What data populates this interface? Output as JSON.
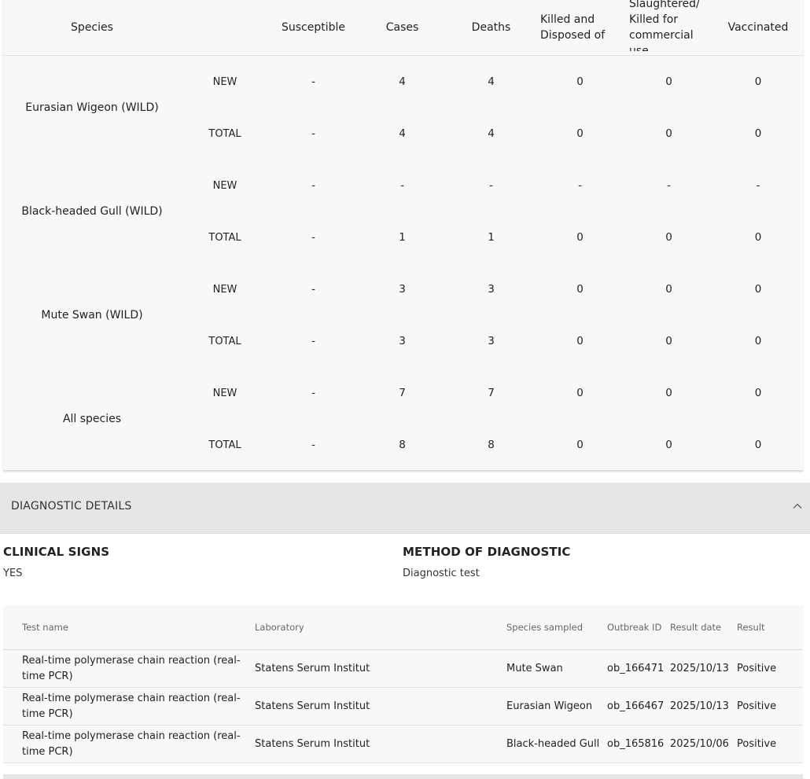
{
  "species_table": {
    "headers": {
      "species": "Species",
      "susceptible": "Susceptible",
      "cases": "Cases",
      "deaths": "Deaths",
      "killed_disposed": "Killed and Disposed of",
      "slaughtered": "Slaughtered/ Killed for commercial use",
      "vaccinated": "Vaccinated"
    },
    "groups": [
      {
        "species": "Eurasian Wigeon (WILD)",
        "rows": [
          {
            "period": "NEW",
            "susceptible": "-",
            "cases": "4",
            "deaths": "4",
            "killed_disposed": "0",
            "slaughtered": "0",
            "vaccinated": "0"
          },
          {
            "period": "TOTAL",
            "susceptible": "-",
            "cases": "4",
            "deaths": "4",
            "killed_disposed": "0",
            "slaughtered": "0",
            "vaccinated": "0"
          }
        ]
      },
      {
        "species": "Black-headed Gull (WILD)",
        "rows": [
          {
            "period": "NEW",
            "susceptible": "-",
            "cases": "-",
            "deaths": "-",
            "killed_disposed": "-",
            "slaughtered": "-",
            "vaccinated": "-"
          },
          {
            "period": "TOTAL",
            "susceptible": "-",
            "cases": "1",
            "deaths": "1",
            "killed_disposed": "0",
            "slaughtered": "0",
            "vaccinated": "0"
          }
        ]
      },
      {
        "species": "Mute Swan (WILD)",
        "rows": [
          {
            "period": "NEW",
            "susceptible": "-",
            "cases": "3",
            "deaths": "3",
            "killed_disposed": "0",
            "slaughtered": "0",
            "vaccinated": "0"
          },
          {
            "period": "TOTAL",
            "susceptible": "-",
            "cases": "3",
            "deaths": "3",
            "killed_disposed": "0",
            "slaughtered": "0",
            "vaccinated": "0"
          }
        ]
      },
      {
        "species": "All species",
        "rows": [
          {
            "period": "NEW",
            "susceptible": "-",
            "cases": "7",
            "deaths": "7",
            "killed_disposed": "0",
            "slaughtered": "0",
            "vaccinated": "0"
          },
          {
            "period": "TOTAL",
            "susceptible": "-",
            "cases": "8",
            "deaths": "8",
            "killed_disposed": "0",
            "slaughtered": "0",
            "vaccinated": "0"
          }
        ]
      }
    ]
  },
  "diagnostic": {
    "title": "DIAGNOSTIC DETAILS",
    "toggle_icon": "chevron-up-icon",
    "clinical_signs": {
      "label": "CLINICAL SIGNS",
      "value": "YES"
    },
    "method": {
      "label": "METHOD OF DIAGNOSTIC",
      "value": "Diagnostic test"
    }
  },
  "tests_table": {
    "headers": {
      "test_name": "Test name",
      "laboratory": "Laboratory",
      "species_sampled": "Species sampled",
      "outbreak_id": "Outbreak ID",
      "result_date": "Result date",
      "result": "Result"
    },
    "rows": [
      {
        "test_name": "Real-time polymerase chain reaction (real-time PCR)",
        "laboratory": "Statens Serum Institut",
        "species_sampled": "Mute Swan",
        "outbreak_id": "ob_166471",
        "result_date": "2025/10/13",
        "result": "Positive"
      },
      {
        "test_name": "Real-time polymerase chain reaction (real-time PCR)",
        "laboratory": "Statens Serum Institut",
        "species_sampled": "Eurasian Wigeon",
        "outbreak_id": "ob_166467",
        "result_date": "2025/10/13",
        "result": "Positive"
      },
      {
        "test_name": "Real-time polymerase chain reaction (real-time PCR)",
        "laboratory": "Statens Serum Institut",
        "species_sampled": "Black-headed Gull",
        "outbreak_id": "ob_165816",
        "result_date": "2025/10/06",
        "result": "Positive"
      }
    ]
  }
}
